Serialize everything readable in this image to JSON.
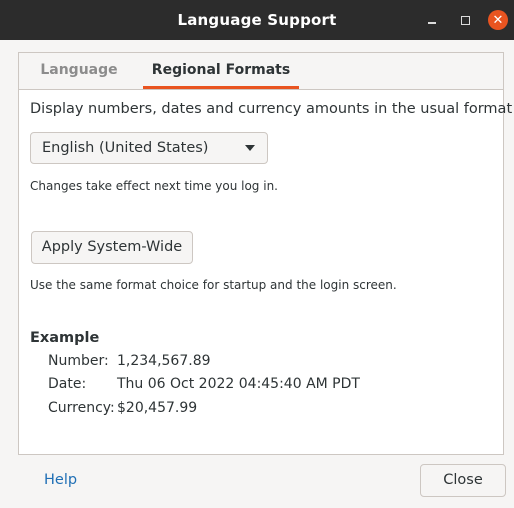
{
  "window": {
    "title": "Language Support"
  },
  "tabs": [
    {
      "label": "Language",
      "active": false
    },
    {
      "label": "Regional Formats",
      "active": true
    }
  ],
  "regional": {
    "description": "Display numbers, dates and currency amounts in the usual format for:",
    "selected_locale": "English (United States)",
    "effect_note": "Changes take effect next time you log in.",
    "apply_button": "Apply System-Wide",
    "apply_note": "Use the same format choice for startup and the login screen."
  },
  "example": {
    "title": "Example",
    "rows": [
      {
        "label": "Number:",
        "value": "1,234,567.89"
      },
      {
        "label": "Date:",
        "value": "Thu 06 Oct 2022 04:45:40 AM PDT"
      },
      {
        "label": "Currency:",
        "value": "$20,457.99"
      }
    ]
  },
  "footer": {
    "help_label": "Help",
    "close_label": "Close"
  },
  "colors": {
    "accent": "#e95420",
    "link": "#1f6fb5",
    "titlebar": "#2c2c2c"
  }
}
